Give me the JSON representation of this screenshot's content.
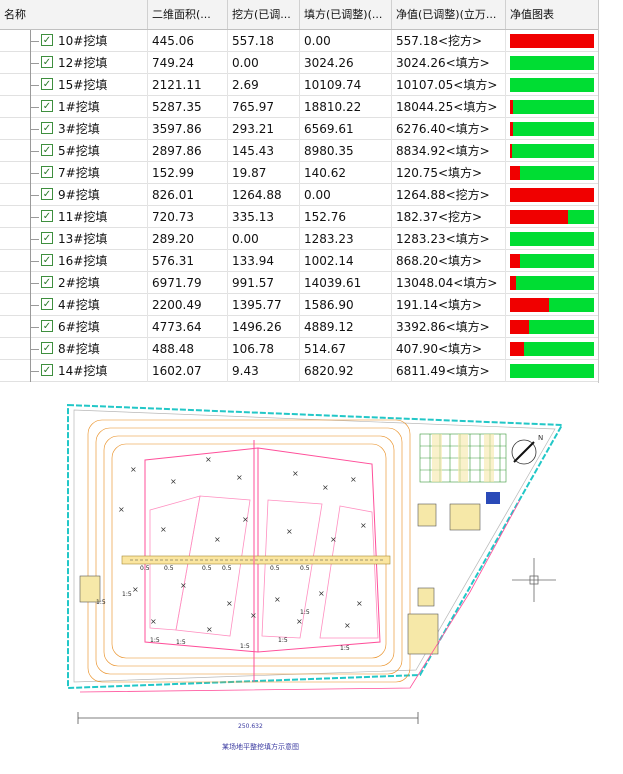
{
  "table": {
    "columns": [
      "名称",
      "二维面积(...",
      "挖方(已调...",
      "填方(已调整)(...",
      "净值(已调整)(立万...",
      "净值图表"
    ],
    "rows": [
      {
        "name": "10#挖填",
        "area": "445.06",
        "cut": "557.18",
        "fill": "0.00",
        "net": "557.18<挖方>",
        "red": 1.0
      },
      {
        "name": "12#挖填",
        "area": "749.24",
        "cut": "0.00",
        "fill": "3024.26",
        "net": "3024.26<填方>",
        "red": 0.0
      },
      {
        "name": "15#挖填",
        "area": "2121.11",
        "cut": "2.69",
        "fill": "10109.74",
        "net": "10107.05<填方>",
        "red": 0.0
      },
      {
        "name": "1#挖填",
        "area": "5287.35",
        "cut": "765.97",
        "fill": "18810.22",
        "net": "18044.25<填方>",
        "red": 0.04
      },
      {
        "name": "3#挖填",
        "area": "3597.86",
        "cut": "293.21",
        "fill": "6569.61",
        "net": "6276.40<填方>",
        "red": 0.04
      },
      {
        "name": "5#挖填",
        "area": "2897.86",
        "cut": "145.43",
        "fill": "8980.35",
        "net": "8834.92<填方>",
        "red": 0.02
      },
      {
        "name": "7#挖填",
        "area": "152.99",
        "cut": "19.87",
        "fill": "140.62",
        "net": "120.75<填方>",
        "red": 0.12
      },
      {
        "name": "9#挖填",
        "area": "826.01",
        "cut": "1264.88",
        "fill": "0.00",
        "net": "1264.88<挖方>",
        "red": 1.0
      },
      {
        "name": "11#挖填",
        "area": "720.73",
        "cut": "335.13",
        "fill": "152.76",
        "net": "182.37<挖方>",
        "red": 0.69
      },
      {
        "name": "13#挖填",
        "area": "289.20",
        "cut": "0.00",
        "fill": "1283.23",
        "net": "1283.23<填方>",
        "red": 0.0
      },
      {
        "name": "16#挖填",
        "area": "576.31",
        "cut": "133.94",
        "fill": "1002.14",
        "net": "868.20<填方>",
        "red": 0.12
      },
      {
        "name": "2#挖填",
        "area": "6971.79",
        "cut": "991.57",
        "fill": "14039.61",
        "net": "13048.04<填方>",
        "red": 0.07
      },
      {
        "name": "4#挖填",
        "area": "2200.49",
        "cut": "1395.77",
        "fill": "1586.90",
        "net": "191.14<填方>",
        "red": 0.47
      },
      {
        "name": "6#挖填",
        "area": "4773.64",
        "cut": "1496.26",
        "fill": "4889.12",
        "net": "3392.86<填方>",
        "red": 0.23
      },
      {
        "name": "8#挖填",
        "area": "488.48",
        "cut": "106.78",
        "fill": "514.67",
        "net": "407.90<填方>",
        "red": 0.17
      },
      {
        "name": "14#挖填",
        "area": "1602.07",
        "cut": "9.43",
        "fill": "6820.92",
        "net": "6811.49<填方>",
        "red": 0.0
      }
    ],
    "check_mark": "✓"
  },
  "drawing": {
    "slope_labels": [
      "0.5",
      "0.5",
      "0.5",
      "0.5",
      "0.5",
      "0.5",
      "1:5",
      "1:5",
      "1:5",
      "1:5",
      "1:5",
      "1:5",
      "1:5",
      "1:5"
    ],
    "dimension": "250.632",
    "north": "N",
    "caption": "某场地平整挖填方示意图"
  },
  "colors": {
    "cut": "#f00000",
    "fill": "#00dd33",
    "site_boundary": "#22c7c7",
    "contour": "#e88a1a",
    "pad_outline": "#ff4f9a"
  }
}
